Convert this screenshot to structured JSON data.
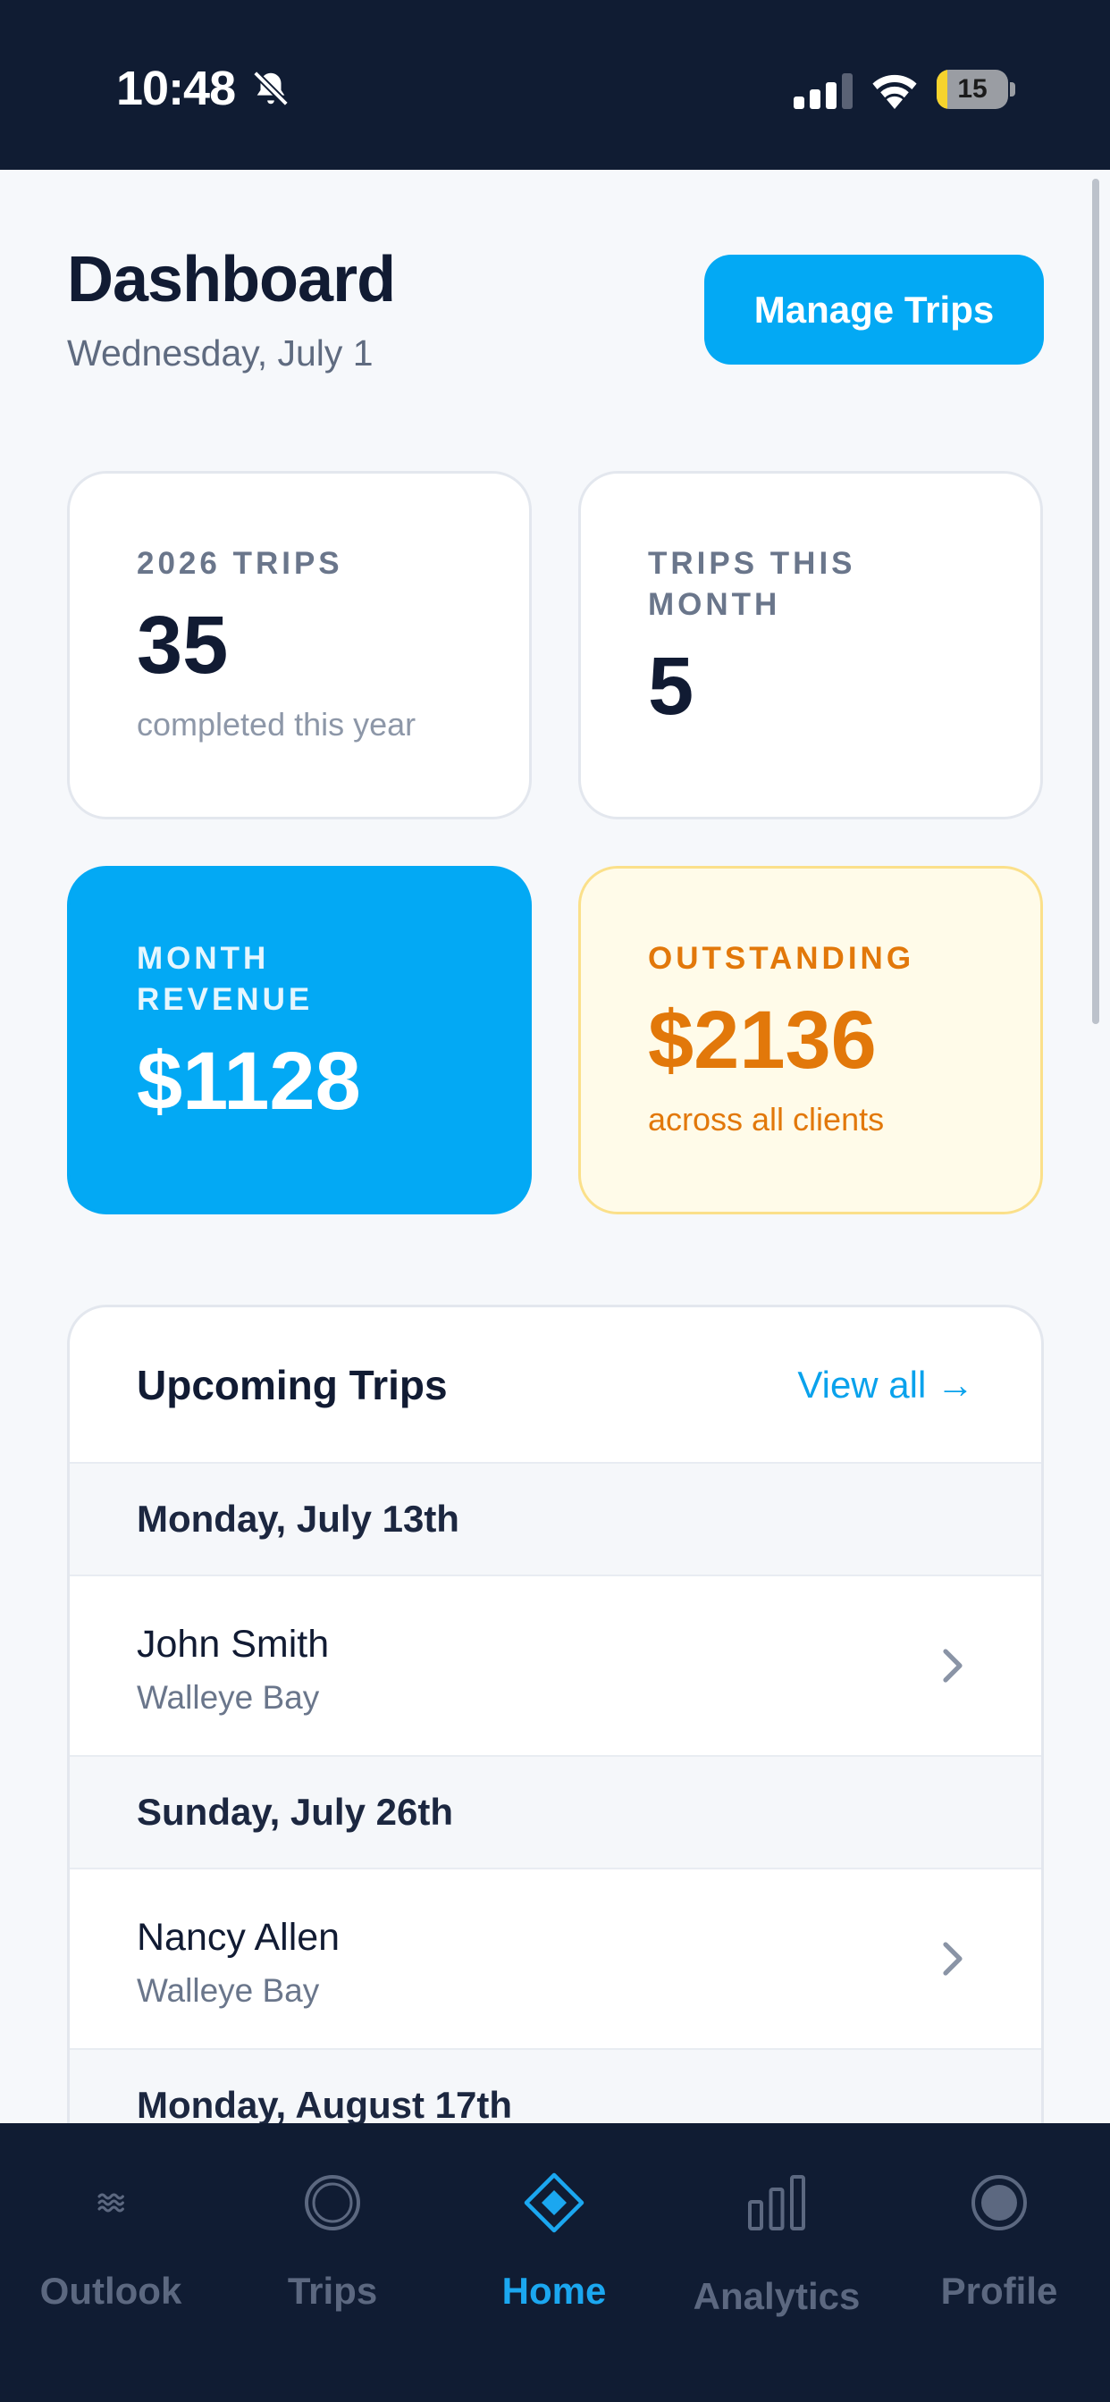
{
  "status_bar": {
    "time": "10:48",
    "battery": "15",
    "battery_level": 0.15,
    "icons": [
      "bell-slash-icon",
      "cellular-signal-icon",
      "wifi-icon",
      "battery-icon"
    ]
  },
  "header": {
    "title": "Dashboard",
    "date": "Wednesday, July 1",
    "manage_button": "Manage Trips"
  },
  "stats": {
    "trips_year": {
      "label": "2026 TRIPS",
      "value": "35",
      "sub": "completed this year"
    },
    "trips_month": {
      "label": "TRIPS THIS MONTH",
      "value": "5"
    },
    "revenue": {
      "label": "MONTH REVENUE",
      "value": "$1128"
    },
    "outstanding": {
      "label": "OUTSTANDING",
      "value": "$2136",
      "sub": "across all clients"
    }
  },
  "upcoming": {
    "title": "Upcoming Trips",
    "view_all": "View all →",
    "groups": [
      {
        "date": "Monday, July 13th",
        "trips": [
          {
            "name": "John Smith",
            "location": "Walleye Bay"
          }
        ]
      },
      {
        "date": "Sunday, July 26th",
        "trips": [
          {
            "name": "Nancy Allen",
            "location": "Walleye Bay"
          }
        ]
      },
      {
        "date": "Monday, August 17th",
        "trips": []
      }
    ]
  },
  "nav": {
    "items": [
      {
        "label": "Outlook",
        "icon": "waves-icon"
      },
      {
        "label": "Trips",
        "icon": "ring-icon"
      },
      {
        "label": "Home",
        "icon": "diamond-icon",
        "active": true
      },
      {
        "label": "Analytics",
        "icon": "bar-chart-icon"
      },
      {
        "label": "Profile",
        "icon": "profile-circle-icon"
      }
    ]
  },
  "colors": {
    "accent": "#03A9F4",
    "dark": "#101C33",
    "warning": "#E2780A",
    "warning_bg": "#FFFBE9"
  }
}
